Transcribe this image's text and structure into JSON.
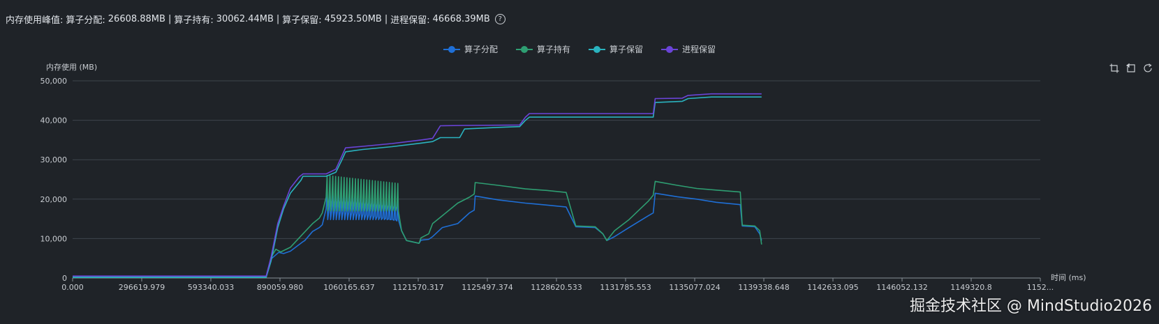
{
  "summary": {
    "label": "内存使用峰值:",
    "alloc_label": "算子分配:",
    "alloc_value": "26608.88MB",
    "hold_label": "算子持有:",
    "hold_value": "30062.44MB",
    "reserve_label": "算子保留:",
    "reserve_value": "45923.50MB",
    "proc_label": "进程保留:",
    "proc_value": "46668.39MB",
    "separator": "|"
  },
  "watermark": "掘金技术社区 @ MindStudio2026",
  "colors": {
    "background": "#1f2328",
    "grid": "#3e444c",
    "alloc": "#1f6fd6",
    "hold": "#2e9e72",
    "reserve": "#2ab3bf",
    "process": "#6a44d8"
  },
  "chart_data": {
    "type": "line",
    "ylabel": "内存使用 (MB)",
    "xlabel": "时间 (ms)",
    "ylim": [
      0,
      50000
    ],
    "y_ticks": [
      "0",
      "10,000",
      "20,000",
      "30,000",
      "40,000",
      "50,000"
    ],
    "x_ticks": [
      "0.000",
      "296619.979",
      "593340.033",
      "890059.980",
      "1060165.637",
      "1121570.317",
      "1125497.374",
      "1128620.533",
      "1131785.553",
      "1135077.024",
      "1139338.648",
      "1142633.095",
      "1146052.132",
      "1149320.8",
      "1152..."
    ],
    "x_domain": [
      0,
      1000
    ],
    "grid": true,
    "legend": "top-center",
    "series": [
      {
        "name": "算子分配",
        "color": "#1f6fd6",
        "envelope": [
          [
            0,
            200
          ],
          [
            200,
            200
          ],
          [
            205,
            4800
          ],
          [
            213,
            6500
          ],
          [
            218,
            6200
          ],
          [
            225,
            6800
          ],
          [
            238,
            9200
          ],
          [
            240,
            9500
          ],
          [
            248,
            11800
          ],
          [
            255,
            12800
          ],
          [
            258,
            13500
          ],
          [
            262,
            17500
          ],
          [
            268,
            17200
          ],
          [
            290,
            16500
          ],
          [
            310,
            15800
          ],
          [
            335,
            14500
          ],
          [
            340,
            12000
          ],
          [
            345,
            9500
          ],
          [
            358,
            8800
          ],
          [
            360,
            9600
          ],
          [
            368,
            9800
          ],
          [
            372,
            10500
          ],
          [
            382,
            12800
          ],
          [
            398,
            13800
          ],
          [
            410,
            16500
          ],
          [
            415,
            17200
          ],
          [
            416,
            20800
          ],
          [
            440,
            19800
          ],
          [
            468,
            19000
          ],
          [
            490,
            18500
          ],
          [
            510,
            18000
          ],
          [
            520,
            13000
          ],
          [
            540,
            12800
          ],
          [
            548,
            11200
          ],
          [
            552,
            9500
          ],
          [
            560,
            10500
          ],
          [
            575,
            12800
          ],
          [
            595,
            15800
          ],
          [
            600,
            16500
          ],
          [
            602,
            21500
          ],
          [
            625,
            20600
          ],
          [
            645,
            20000
          ],
          [
            665,
            19200
          ],
          [
            690,
            18600
          ],
          [
            692,
            13200
          ],
          [
            705,
            13000
          ],
          [
            710,
            11200
          ],
          [
            712,
            9500
          ]
        ],
        "spikes": {
          "start": 262,
          "end": 338,
          "count": 26,
          "low": 14800,
          "high": 22500
        }
      },
      {
        "name": "算子持有",
        "color": "#2e9e72",
        "envelope": [
          [
            0,
            200
          ],
          [
            200,
            200
          ],
          [
            205,
            5200
          ],
          [
            210,
            7300
          ],
          [
            215,
            6600
          ],
          [
            225,
            7800
          ],
          [
            238,
            11200
          ],
          [
            248,
            13800
          ],
          [
            255,
            15200
          ],
          [
            258,
            16500
          ],
          [
            262,
            20500
          ],
          [
            268,
            20000
          ],
          [
            290,
            19600
          ],
          [
            310,
            19000
          ],
          [
            335,
            18200
          ],
          [
            340,
            12000
          ],
          [
            345,
            9500
          ],
          [
            358,
            8800
          ],
          [
            360,
            10200
          ],
          [
            368,
            11200
          ],
          [
            372,
            13800
          ],
          [
            382,
            15800
          ],
          [
            398,
            19000
          ],
          [
            410,
            20500
          ],
          [
            415,
            21300
          ],
          [
            416,
            24200
          ],
          [
            440,
            23500
          ],
          [
            468,
            22600
          ],
          [
            490,
            22200
          ],
          [
            510,
            21700
          ],
          [
            520,
            13200
          ],
          [
            540,
            13000
          ],
          [
            548,
            11200
          ],
          [
            552,
            9500
          ],
          [
            560,
            12000
          ],
          [
            575,
            14800
          ],
          [
            595,
            19500
          ],
          [
            600,
            21000
          ],
          [
            602,
            24500
          ],
          [
            625,
            23500
          ],
          [
            645,
            22700
          ],
          [
            665,
            22300
          ],
          [
            690,
            21800
          ],
          [
            692,
            13400
          ],
          [
            705,
            13200
          ],
          [
            710,
            12000
          ],
          [
            712,
            8500
          ]
        ],
        "spikes": {
          "start": 262,
          "end": 338,
          "count": 26,
          "low": 17000,
          "high": 26000
        }
      },
      {
        "name": "算子保留",
        "color": "#2ab3bf",
        "envelope": [
          [
            0,
            200
          ],
          [
            200,
            200
          ],
          [
            205,
            4200
          ],
          [
            212,
            12800
          ],
          [
            218,
            17500
          ],
          [
            225,
            21500
          ],
          [
            236,
            24800
          ],
          [
            238,
            25800
          ],
          [
            262,
            25800
          ],
          [
            272,
            26800
          ],
          [
            278,
            29800
          ],
          [
            282,
            32000
          ],
          [
            300,
            32600
          ],
          [
            330,
            33300
          ],
          [
            360,
            34200
          ],
          [
            372,
            34600
          ],
          [
            380,
            35600
          ],
          [
            400,
            35600
          ],
          [
            405,
            37800
          ],
          [
            440,
            38200
          ],
          [
            462,
            38400
          ],
          [
            468,
            40000
          ],
          [
            472,
            40800
          ],
          [
            500,
            40800
          ],
          [
            560,
            40800
          ],
          [
            600,
            40800
          ],
          [
            602,
            44500
          ],
          [
            630,
            44800
          ],
          [
            636,
            45500
          ],
          [
            660,
            45900
          ],
          [
            712,
            45900
          ]
        ]
      },
      {
        "name": "进程保留",
        "color": "#6a44d8",
        "envelope": [
          [
            0,
            500
          ],
          [
            200,
            500
          ],
          [
            205,
            5200
          ],
          [
            212,
            13800
          ],
          [
            218,
            18200
          ],
          [
            225,
            22800
          ],
          [
            234,
            25600
          ],
          [
            238,
            26400
          ],
          [
            262,
            26400
          ],
          [
            272,
            27600
          ],
          [
            278,
            30800
          ],
          [
            282,
            33000
          ],
          [
            300,
            33400
          ],
          [
            330,
            34100
          ],
          [
            360,
            35000
          ],
          [
            372,
            35400
          ],
          [
            380,
            38600
          ],
          [
            405,
            38700
          ],
          [
            462,
            38800
          ],
          [
            468,
            40800
          ],
          [
            472,
            41700
          ],
          [
            560,
            41700
          ],
          [
            600,
            41700
          ],
          [
            602,
            45500
          ],
          [
            630,
            45600
          ],
          [
            636,
            46300
          ],
          [
            660,
            46700
          ],
          [
            712,
            46700
          ]
        ]
      }
    ]
  },
  "toolbox": {
    "zoom_title": "区域缩放",
    "restore_title": "区域缩放还原",
    "reset_title": "还原"
  }
}
